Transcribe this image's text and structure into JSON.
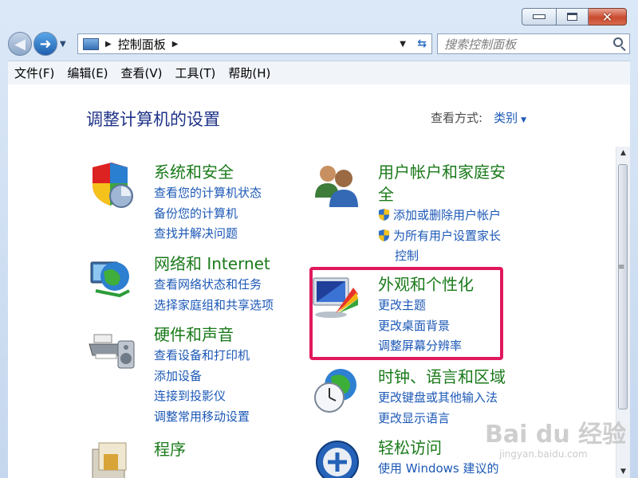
{
  "address": {
    "breadcrumb": "控制面板",
    "search_placeholder": "搜索控制面板"
  },
  "menu": [
    "文件(F)",
    "编辑(E)",
    "查看(V)",
    "工具(T)",
    "帮助(H)"
  ],
  "page": {
    "title": "调整计算机的设置",
    "view_by_label": "查看方式:",
    "view_by_value": "类别"
  },
  "categories": [
    {
      "title": "系统和安全",
      "links": [
        "查看您的计算机状态",
        "备份您的计算机",
        "查找并解决问题"
      ]
    },
    {
      "title": "网络和 Internet",
      "links": [
        "查看网络状态和任务",
        "选择家庭组和共享选项"
      ]
    },
    {
      "title": "硬件和声音",
      "links": [
        "查看设备和打印机",
        "添加设备",
        "连接到投影仪",
        "调整常用移动设置"
      ]
    },
    {
      "title": "程序",
      "links": []
    },
    {
      "title_line1": "用户帐户和家庭安",
      "title_line2": "全",
      "links": [
        "添加或删除用户帐户",
        "为所有用户设置家长",
        "控制"
      ]
    },
    {
      "title": "外观和个性化",
      "links": [
        "更改主题",
        "更改桌面背景",
        "调整屏幕分辨率"
      ]
    },
    {
      "title": "时钟、语言和区域",
      "links": [
        "更改键盘或其他输入法",
        "更改显示语言"
      ]
    },
    {
      "title": "轻松访问",
      "links": [
        "使用 Windows 建议的"
      ]
    }
  ],
  "watermark": {
    "main": "Bai du 经验",
    "sub": "jingyan.baidu.com"
  },
  "colors": {
    "category_title": "#1a7a1a",
    "link": "#1c58b6",
    "page_title": "#1e3287",
    "highlight_border": "#e1185e"
  }
}
